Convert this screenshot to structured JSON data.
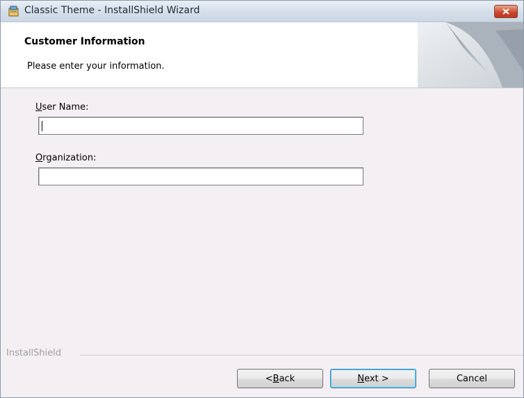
{
  "window": {
    "title": "Classic Theme - InstallShield Wizard"
  },
  "header": {
    "title": "Customer Information",
    "subtitle": "Please enter your information."
  },
  "form": {
    "user_name": {
      "label_accel": "U",
      "label_rest": "ser Name:",
      "value": ""
    },
    "organization": {
      "label_accel": "O",
      "label_rest": "rganization:",
      "value": ""
    }
  },
  "footer": {
    "brand": "InstallShield"
  },
  "buttons": {
    "back": {
      "prefix": "< ",
      "accel": "B",
      "rest": "ack"
    },
    "next": {
      "accel": "N",
      "rest": "ext >"
    },
    "cancel": {
      "label": "Cancel"
    }
  }
}
